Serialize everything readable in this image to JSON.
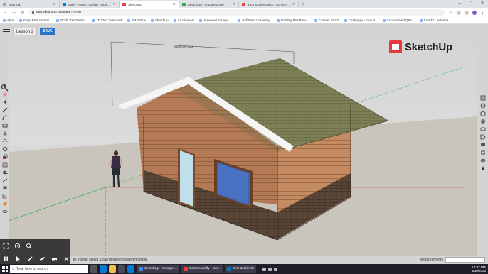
{
  "browser": {
    "tabs": [
      {
        "label": "New Tab",
        "active": false
      },
      {
        "label": "Mail - Rosen, Stefan - Outlook",
        "active": false
      },
      {
        "label": "SketchUp",
        "active": true
      },
      {
        "label": "SketchUp - Google Drive",
        "active": false
      },
      {
        "label": "Your Screencasts - Screencastify",
        "active": false
      }
    ],
    "url": "app.sketchup.com/app?hl=en",
    "bookmarks": [
      "Apps",
      "Kings Park Central...",
      "Boxlit 10020 Astro...",
      "ID CNC Video Hub",
      "KR Online",
      "SketchUp",
      "Air Cleaners",
      "Approved Surveys f...",
      "Ball State University...",
      "Building Part Panel...",
      "Careers SCAD",
      "Challenger - Free B...",
      "Consolidated Q&A...",
      "CoreTT - industria..."
    ]
  },
  "sketchup": {
    "file_name": "Lesson 2",
    "save_label": "SAVE",
    "logo_text": "SketchUp",
    "dimension_label": "Stefan Rosen",
    "status_text": "to extend select. Drag mouse to select multiple.",
    "measurements_label": "Measurements",
    "left_tools": [
      "select-icon",
      "eraser-icon",
      "paint-bucket-icon",
      "line-icon",
      "arc-icon",
      "rectangle-icon",
      "push-pull-icon",
      "move-icon",
      "rotate-icon",
      "scale-icon",
      "offset-icon",
      "tape-measure-icon",
      "dimension-icon",
      "text-icon",
      "axes-icon",
      "section-plane-icon",
      "orbit-icon"
    ],
    "right_tools": [
      "entity-info-icon",
      "instructor-icon",
      "components-icon",
      "materials-icon",
      "styles-icon",
      "tags-icon",
      "scenes-icon",
      "shadows-icon",
      "display-icon",
      "solid-tools-icon"
    ],
    "tray_top": [
      "zoom-extents-icon",
      "orbit-icon",
      "zoom-icon"
    ],
    "tray_bottom": [
      "pause-icon",
      "select-icon",
      "pencil-icon",
      "marker-icon",
      "camera-icon",
      "close-icon"
    ]
  },
  "taskbar": {
    "search_placeholder": "Type here to search",
    "apps": [
      {
        "label": "SketchUp - Google ...",
        "color": "#4285f4"
      },
      {
        "label": "Screencastify - Scr...",
        "color": "#ea4335"
      },
      {
        "label": "Snip & Sketch",
        "color": "#0078d4"
      }
    ],
    "time": "12:32 PM",
    "date": "3/30/2020"
  },
  "colors": {
    "brand": "#e33b3b",
    "save_button": "#2b72c9",
    "sky": "#d6d6d6",
    "ground": "#c9c5bd",
    "siding": "#b47a55",
    "roof": "#7d7f55",
    "brick": "#5a4636"
  }
}
